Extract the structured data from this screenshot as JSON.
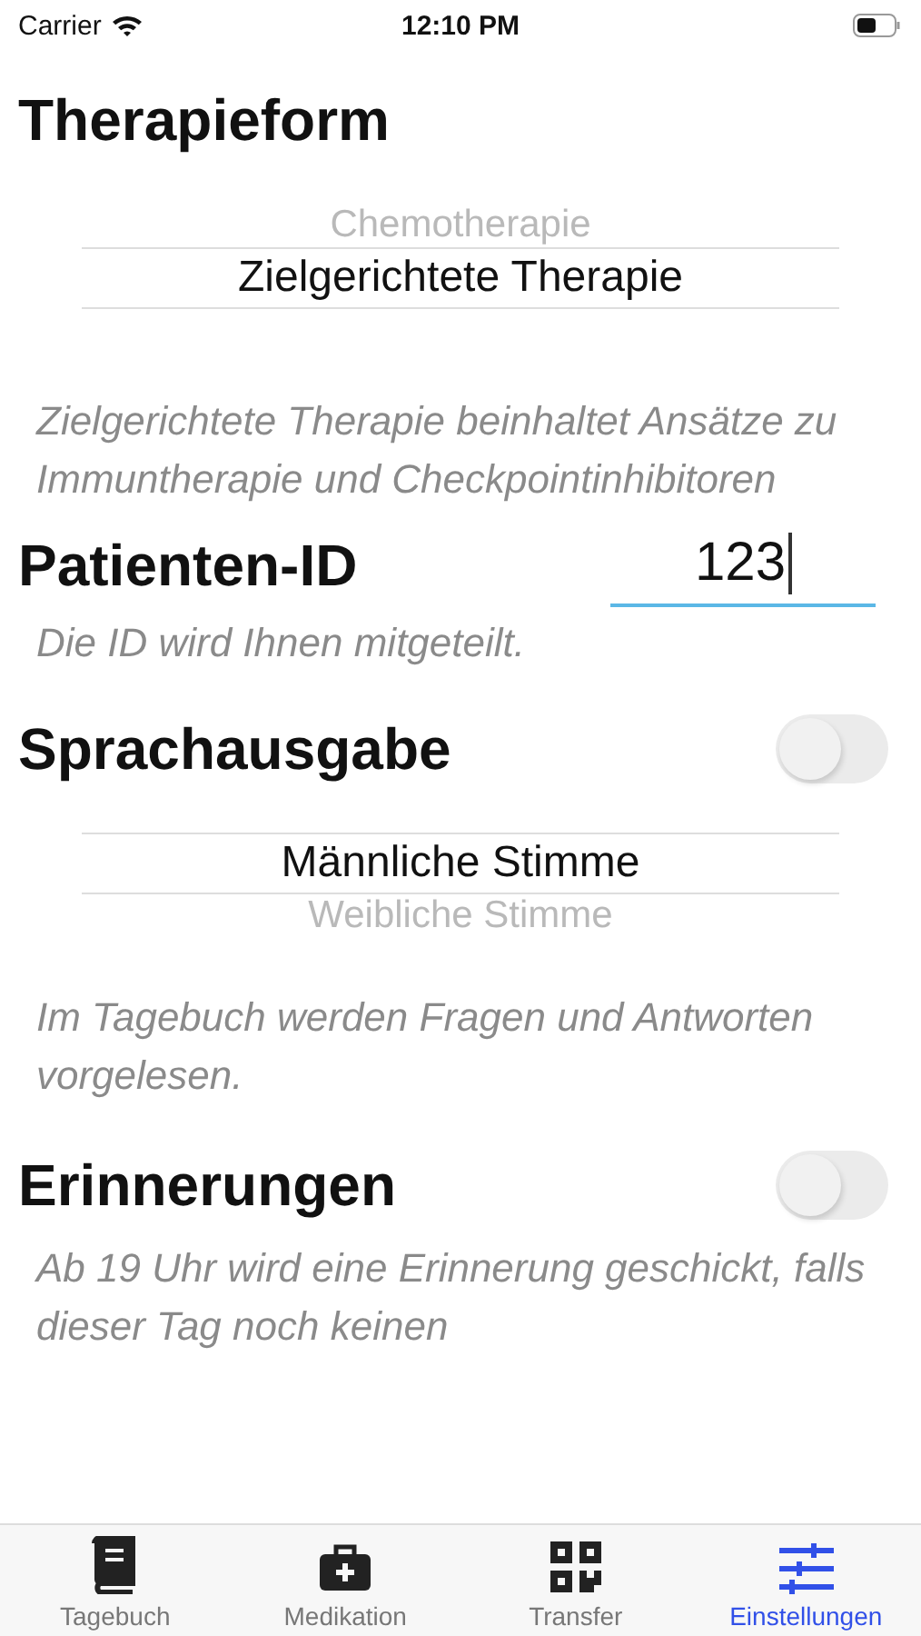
{
  "status_bar": {
    "carrier": "Carrier",
    "time": "12:10 PM"
  },
  "therapy": {
    "title": "Therapieform",
    "options": [
      {
        "label": "Chemotherapie",
        "selected": false
      },
      {
        "label": "Zielgerichtete Therapie",
        "selected": true
      }
    ],
    "description": "Zielgerichtete Therapie beinhaltet Ansätze zu Immuntherapie und Checkpointinhibitoren"
  },
  "patient_id": {
    "label": "Patienten-ID",
    "value": "123",
    "hint": "Die ID wird Ihnen mitgeteilt."
  },
  "speech": {
    "title": "Sprachausgabe",
    "on": false,
    "options": [
      {
        "label": "Männliche Stimme",
        "selected": true
      },
      {
        "label": "Weibliche Stimme",
        "selected": false
      }
    ],
    "description": "Im Tagebuch werden Fragen und Antworten vorgelesen."
  },
  "reminders": {
    "title": "Erinnerungen",
    "on": false,
    "description": "Ab 19 Uhr wird eine Erinnerung geschickt, falls dieser Tag noch keinen"
  },
  "tabs": [
    {
      "label": "Tagebuch",
      "kind": "book",
      "selected": false
    },
    {
      "label": "Medikation",
      "kind": "kit",
      "selected": false
    },
    {
      "label": "Transfer",
      "kind": "qr",
      "selected": false
    },
    {
      "label": "Einstellungen",
      "kind": "sliders",
      "selected": true
    }
  ]
}
